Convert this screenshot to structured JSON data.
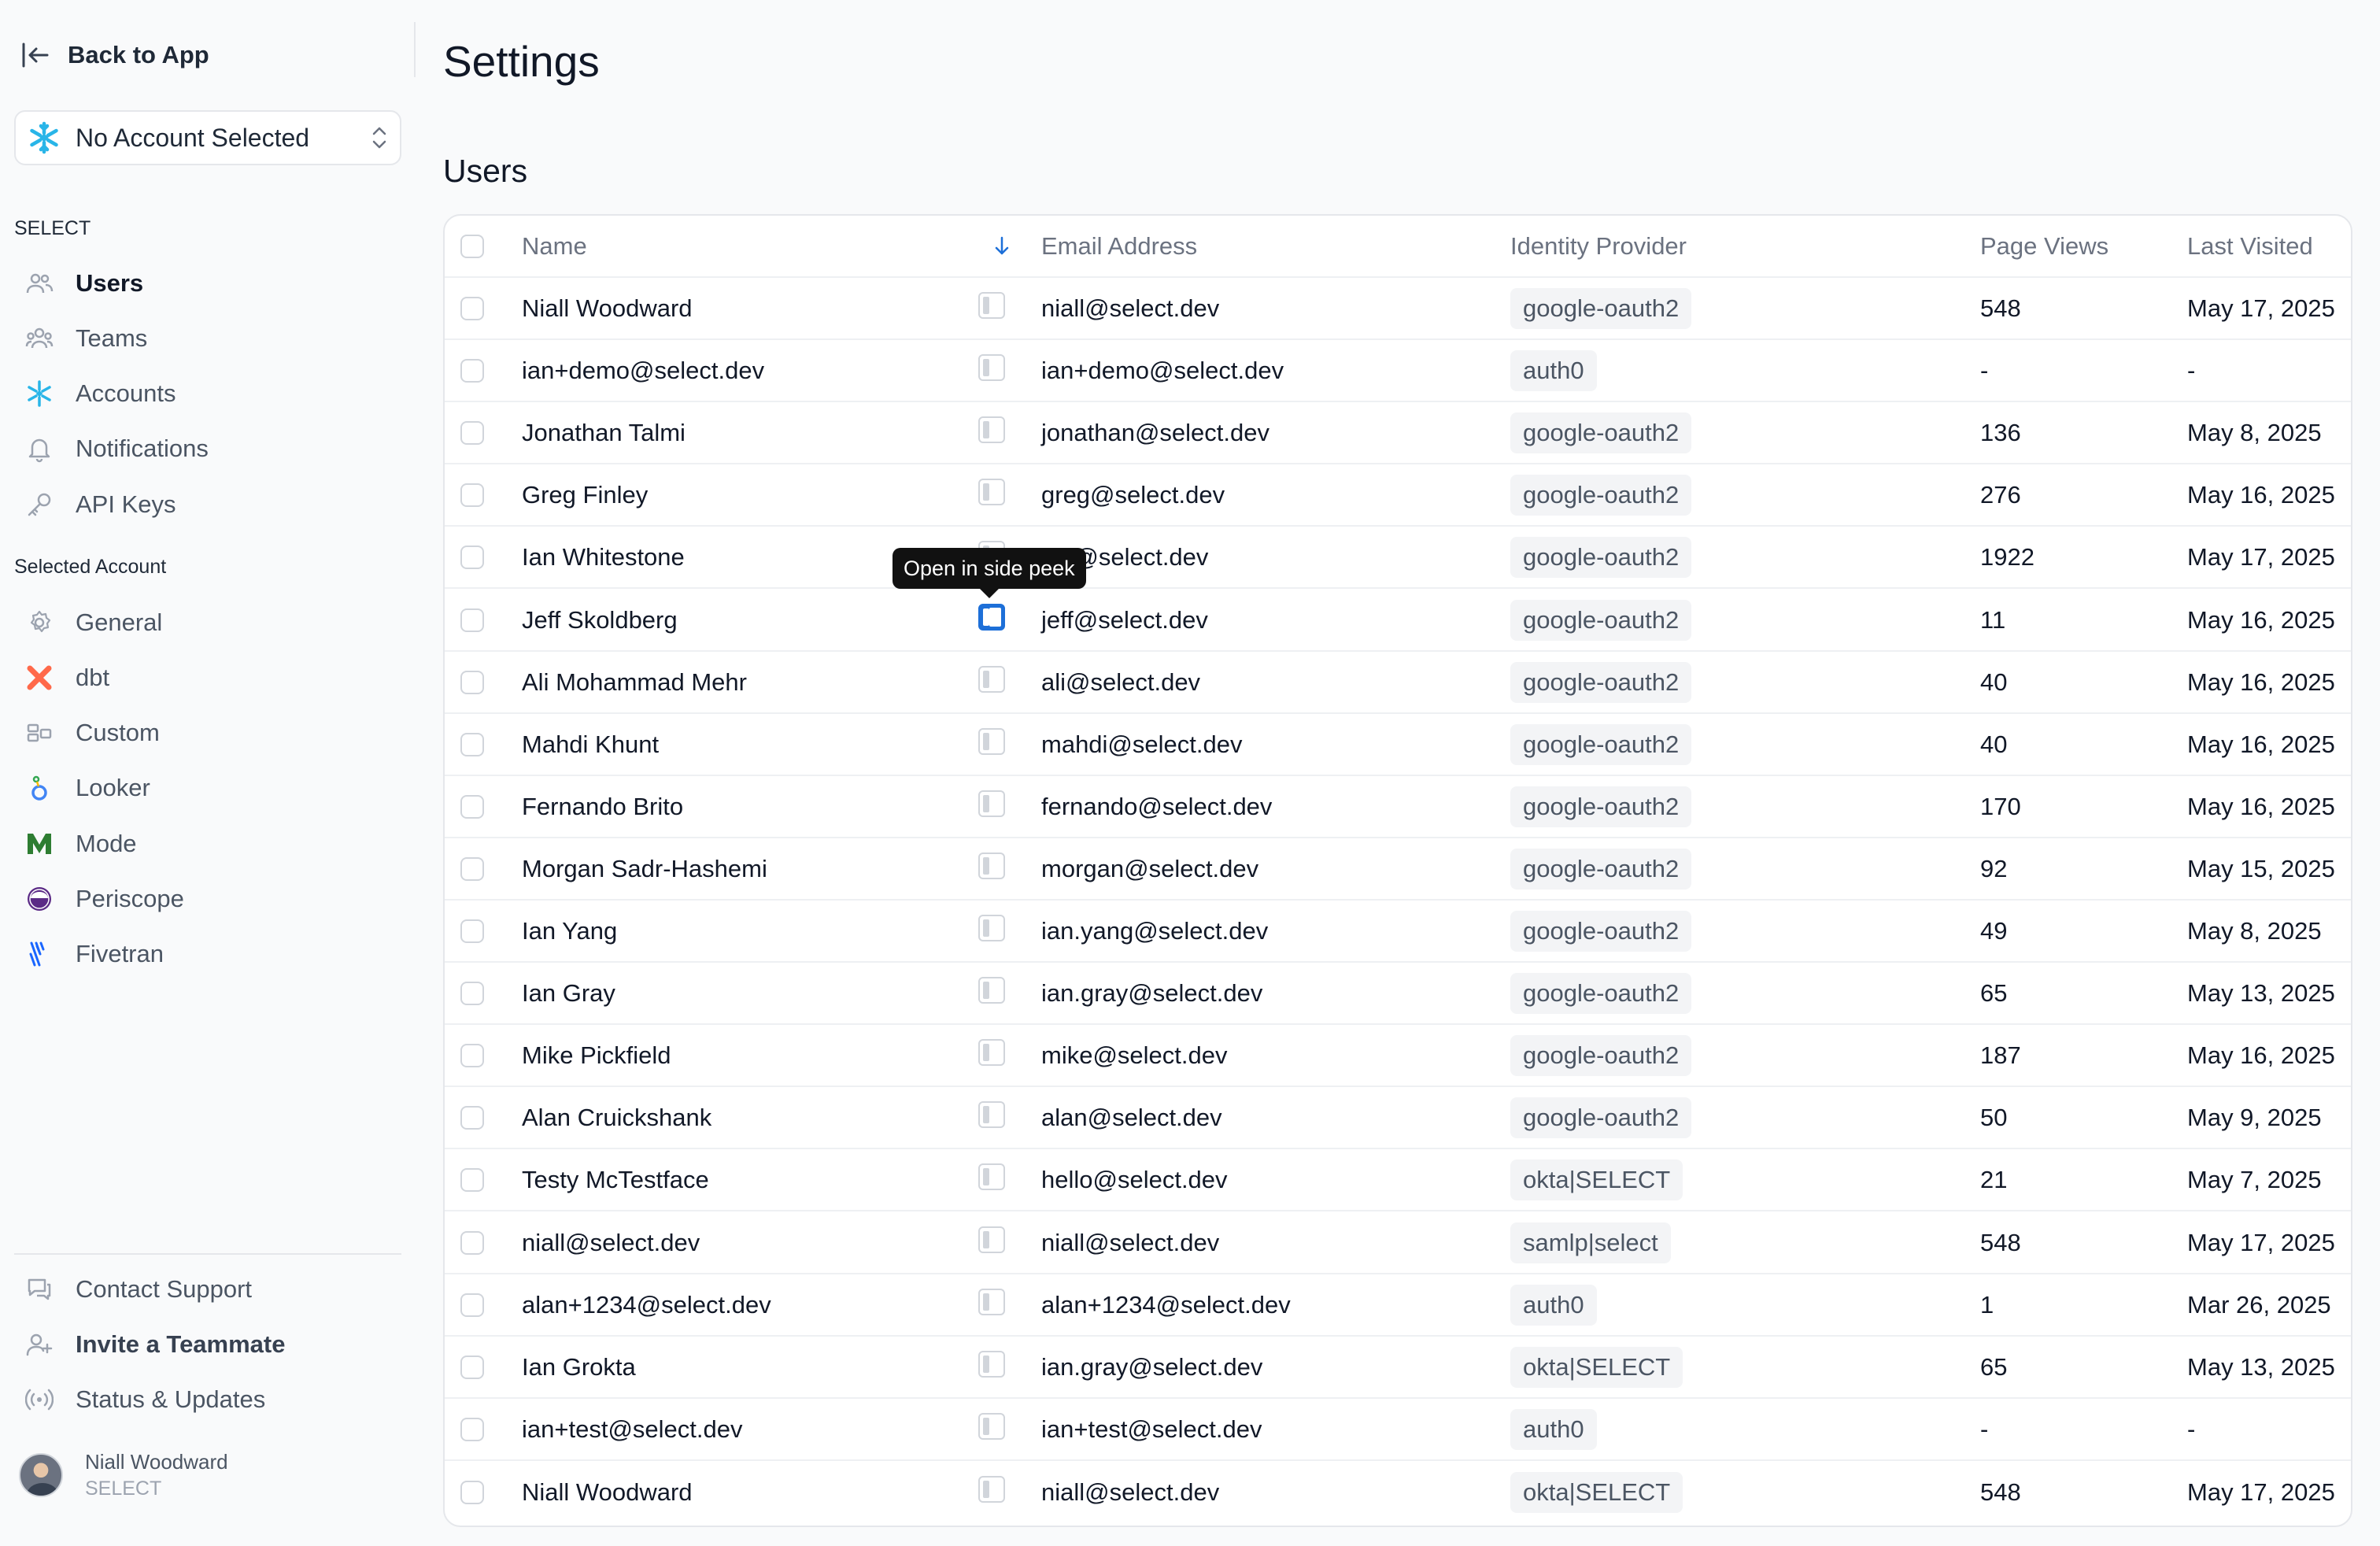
{
  "sidebar": {
    "back_label": "Back to App",
    "account_select": "No Account Selected",
    "section_select": "SELECT",
    "select_items": [
      {
        "label": "Users",
        "icon": "users-icon"
      },
      {
        "label": "Teams",
        "icon": "teams-icon"
      },
      {
        "label": "Accounts",
        "icon": "snowflake-icon"
      },
      {
        "label": "Notifications",
        "icon": "bell-icon"
      },
      {
        "label": "API Keys",
        "icon": "key-icon"
      }
    ],
    "section_account": "Selected Account",
    "account_items": [
      {
        "label": "General",
        "icon": "gear-icon"
      },
      {
        "label": "dbt",
        "icon": "dbt-icon"
      },
      {
        "label": "Custom",
        "icon": "custom-icon"
      },
      {
        "label": "Looker",
        "icon": "looker-icon"
      },
      {
        "label": "Mode",
        "icon": "mode-icon"
      },
      {
        "label": "Periscope",
        "icon": "periscope-icon"
      },
      {
        "label": "Fivetran",
        "icon": "fivetran-icon"
      }
    ],
    "bottom_items": [
      {
        "label": "Contact Support",
        "icon": "chat-icon"
      },
      {
        "label": "Invite a Teammate",
        "icon": "user-plus-icon"
      },
      {
        "label": "Status & Updates",
        "icon": "broadcast-icon"
      }
    ],
    "user_name": "Niall Woodward",
    "user_org": "SELECT"
  },
  "main": {
    "title": "Settings",
    "section": "Users",
    "tooltip": "Open in side peek",
    "columns": [
      "Name",
      "Email Address",
      "Identity Provider",
      "Page Views",
      "Last Visited"
    ],
    "rows": [
      {
        "name": "Niall Woodward",
        "email": "niall@select.dev",
        "idp": "google-oauth2",
        "views": "548",
        "last": "May 17, 2025"
      },
      {
        "name": "ian+demo@select.dev",
        "email": "ian+demo@select.dev",
        "idp": "auth0",
        "views": "-",
        "last": "-"
      },
      {
        "name": "Jonathan Talmi",
        "email": "jonathan@select.dev",
        "idp": "google-oauth2",
        "views": "136",
        "last": "May 8, 2025"
      },
      {
        "name": "Greg Finley",
        "email": "greg@select.dev",
        "idp": "google-oauth2",
        "views": "276",
        "last": "May 16, 2025"
      },
      {
        "name": "Ian Whitestone",
        "email": "ian@select.dev",
        "idp": "google-oauth2",
        "views": "1922",
        "last": "May 17, 2025"
      },
      {
        "name": "Jeff Skoldberg",
        "email": "jeff@select.dev",
        "idp": "google-oauth2",
        "views": "11",
        "last": "May 16, 2025"
      },
      {
        "name": "Ali Mohammad Mehr",
        "email": "ali@select.dev",
        "idp": "google-oauth2",
        "views": "40",
        "last": "May 16, 2025"
      },
      {
        "name": "Mahdi Khunt",
        "email": "mahdi@select.dev",
        "idp": "google-oauth2",
        "views": "40",
        "last": "May 16, 2025"
      },
      {
        "name": "Fernando Brito",
        "email": "fernando@select.dev",
        "idp": "google-oauth2",
        "views": "170",
        "last": "May 16, 2025"
      },
      {
        "name": "Morgan Sadr-Hashemi",
        "email": "morgan@select.dev",
        "idp": "google-oauth2",
        "views": "92",
        "last": "May 15, 2025"
      },
      {
        "name": "Ian Yang",
        "email": "ian.yang@select.dev",
        "idp": "google-oauth2",
        "views": "49",
        "last": "May 8, 2025"
      },
      {
        "name": "Ian Gray",
        "email": "ian.gray@select.dev",
        "idp": "google-oauth2",
        "views": "65",
        "last": "May 13, 2025"
      },
      {
        "name": "Mike Pickfield",
        "email": "mike@select.dev",
        "idp": "google-oauth2",
        "views": "187",
        "last": "May 16, 2025"
      },
      {
        "name": "Alan Cruickshank",
        "email": "alan@select.dev",
        "idp": "google-oauth2",
        "views": "50",
        "last": "May 9, 2025"
      },
      {
        "name": "Testy McTestface",
        "email": "hello@select.dev",
        "idp": "okta|SELECT",
        "views": "21",
        "last": "May 7, 2025"
      },
      {
        "name": "niall@select.dev",
        "email": "niall@select.dev",
        "idp": "samlp|select",
        "views": "548",
        "last": "May 17, 2025"
      },
      {
        "name": "alan+1234@select.dev",
        "email": "alan+1234@select.dev",
        "idp": "auth0",
        "views": "1",
        "last": "Mar 26, 2025"
      },
      {
        "name": "Ian Grokta",
        "email": "ian.gray@select.dev",
        "idp": "okta|SELECT",
        "views": "65",
        "last": "May 13, 2025"
      },
      {
        "name": "ian+test@select.dev",
        "email": "ian+test@select.dev",
        "idp": "auth0",
        "views": "-",
        "last": "-"
      },
      {
        "name": "Niall Woodward",
        "email": "niall@select.dev",
        "idp": "okta|SELECT",
        "views": "548",
        "last": "May 17, 2025"
      }
    ]
  },
  "colors": {
    "accent": "#1d6fd8",
    "snowflake": "#29b5e8",
    "dbt": "#ff694a",
    "mode": "#2e7d32",
    "periscope": "#5b2a86"
  }
}
